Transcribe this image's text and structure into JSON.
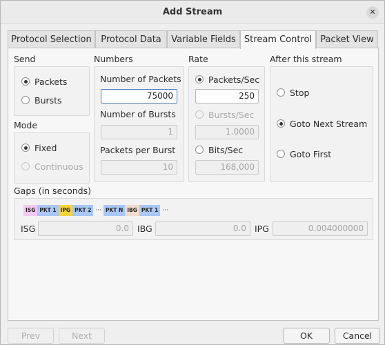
{
  "window": {
    "title": "Add Stream"
  },
  "tabs": [
    {
      "label": "Protocol Selection"
    },
    {
      "label": "Protocol Data"
    },
    {
      "label": "Variable Fields"
    },
    {
      "label": "Stream Control"
    },
    {
      "label": "Packet View"
    }
  ],
  "send": {
    "title": "Send",
    "options": [
      "Packets",
      "Bursts"
    ],
    "selected": "Packets"
  },
  "mode": {
    "title": "Mode",
    "options": [
      "Fixed",
      "Continuous"
    ],
    "selected": "Fixed"
  },
  "numbers": {
    "title": "Numbers",
    "packets_label": "Number of Packets",
    "packets_value": "75000",
    "bursts_label": "Number of Bursts",
    "bursts_value": "1",
    "ppb_label": "Packets per Burst",
    "ppb_value": "10"
  },
  "rate": {
    "title": "Rate",
    "pps_label": "Packets/Sec",
    "pps_value": "250",
    "bps_label": "Bursts/Sec",
    "bps_value": "1.0000",
    "bits_label": "Bits/Sec",
    "bits_value": "168,000",
    "selected": "Packets/Sec"
  },
  "after": {
    "title": "After this stream",
    "options": [
      "Stop",
      "Goto Next Stream",
      "Goto First"
    ],
    "selected": "Goto Next Stream"
  },
  "gaps": {
    "title": "Gaps (in seconds)",
    "diagram": [
      {
        "text": "ISG",
        "color": "#f3c8f3"
      },
      {
        "text": "PKT 1",
        "color": "#a9c7f5"
      },
      {
        "text": "IPG",
        "color": "#f5d43a"
      },
      {
        "text": "PKT 2",
        "color": "#a9c7f5"
      },
      {
        "text": "···",
        "color": ""
      },
      {
        "text": "PKT N",
        "color": "#a9c7f5"
      },
      {
        "text": "IBG",
        "color": "#f0dccc"
      },
      {
        "text": "PKT 1",
        "color": "#a9c7f5"
      },
      {
        "text": "···",
        "color": ""
      }
    ],
    "isg_label": "ISG",
    "isg_value": "0.0",
    "ibg_label": "IBG",
    "ibg_value": "0.0",
    "ipg_label": "IPG",
    "ipg_value": "0.004000000"
  },
  "buttons": {
    "prev": "Prev",
    "next": "Next",
    "ok": "OK",
    "cancel": "Cancel"
  },
  "icons": {
    "close": "close-icon"
  }
}
